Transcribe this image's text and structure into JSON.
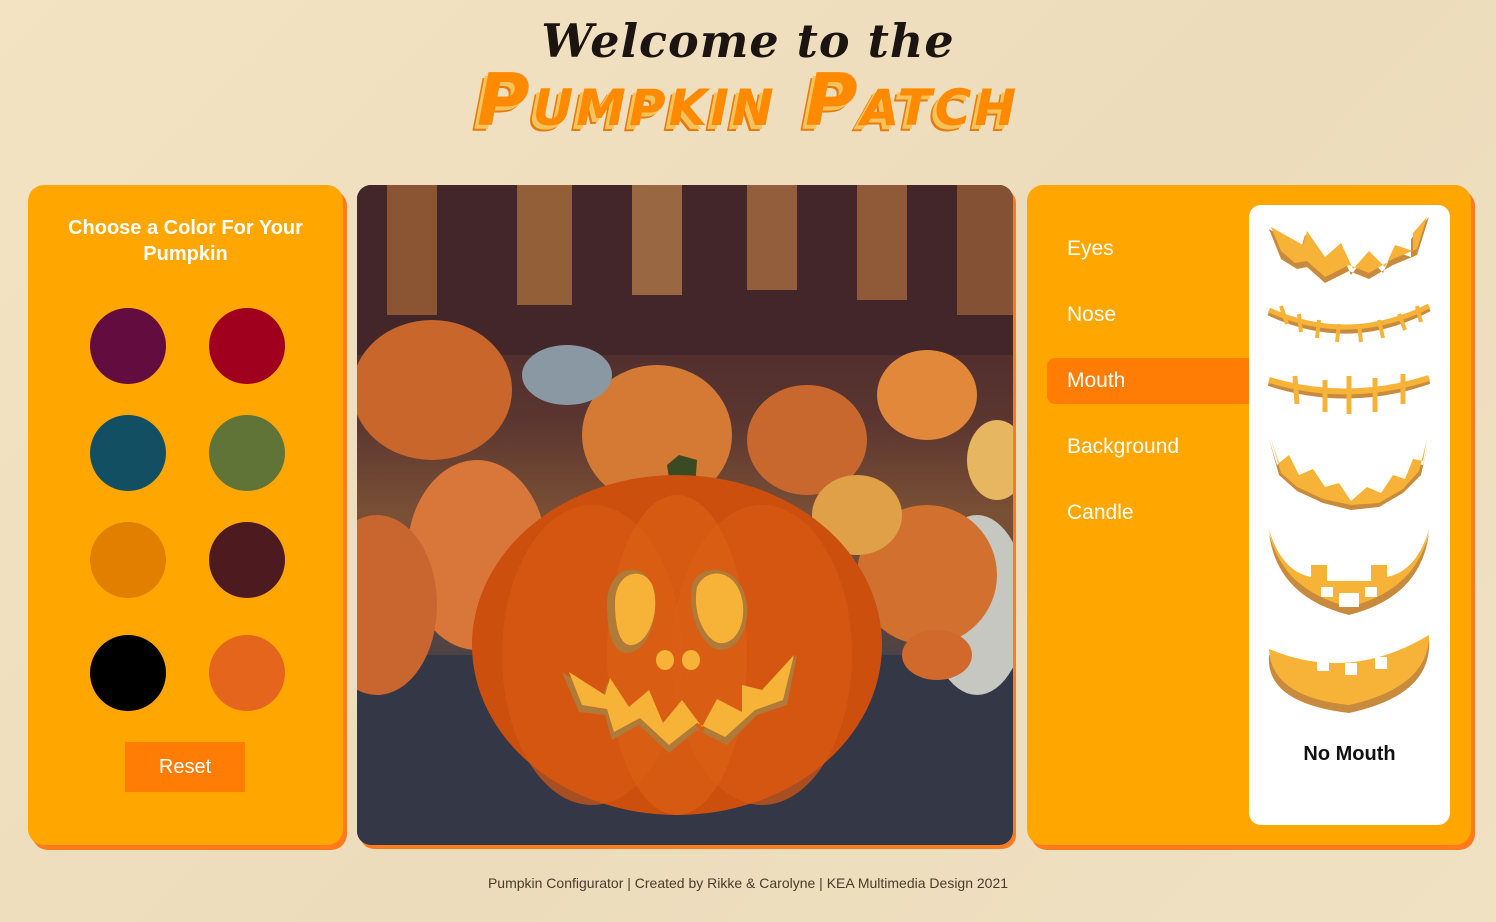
{
  "header": {
    "welcome": "Welcome to the",
    "title": "Pumpkin Patch"
  },
  "color_panel": {
    "heading": "Choose a Color For Your Pumpkin",
    "swatches": [
      "#630c3f",
      "#a0001d",
      "#124f62",
      "#607438",
      "#e27f00",
      "#4d1a1f",
      "#000000",
      "#e5651c"
    ],
    "reset_label": "Reset"
  },
  "menu": {
    "items": [
      "Eyes",
      "Nose",
      "Mouth",
      "Background",
      "Candle"
    ],
    "active": "Mouth"
  },
  "mouth_options": {
    "items": [
      "jagged-mouth-icon",
      "stitched-smile-icon",
      "stitched-line-icon",
      "zigzag-smile-icon",
      "block-teeth-grin-icon",
      "wide-teeth-grin-icon"
    ],
    "no_mouth_label": "No Mouth"
  },
  "footer": {
    "text": "Pumpkin Configurator | Created by Rikke & Carolyne | KEA Multimedia Design 2021"
  },
  "colors": {
    "panel": "#ffa600",
    "accent": "#ff7d04",
    "mouth_fill": "#f7b338",
    "mouth_shadow": "#b07a38"
  }
}
